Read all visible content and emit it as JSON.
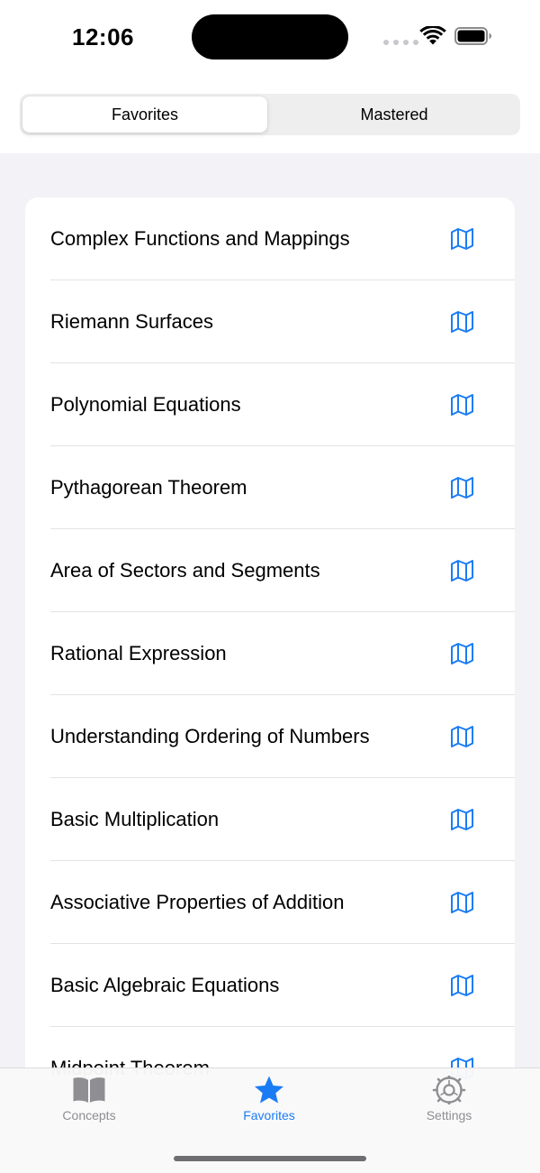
{
  "status_bar": {
    "time": "12:06"
  },
  "segmented_control": {
    "segments": [
      {
        "label": "Favorites",
        "selected": true
      },
      {
        "label": "Mastered",
        "selected": false
      }
    ]
  },
  "list": {
    "item_icon": "map-icon",
    "items": [
      {
        "label": "Complex Functions and Mappings"
      },
      {
        "label": "Riemann Surfaces"
      },
      {
        "label": "Polynomial Equations"
      },
      {
        "label": "Pythagorean Theorem"
      },
      {
        "label": "Area of Sectors and Segments"
      },
      {
        "label": "Rational Expression"
      },
      {
        "label": "Understanding Ordering of Numbers"
      },
      {
        "label": "Basic Multiplication"
      },
      {
        "label": "Associative Properties of Addition"
      },
      {
        "label": "Basic Algebraic Equations"
      },
      {
        "label": "Midpoint Theorem"
      }
    ]
  },
  "tab_bar": {
    "tabs": [
      {
        "label": "Concepts",
        "icon": "book-icon",
        "active": false
      },
      {
        "label": "Favorites",
        "icon": "star-icon",
        "active": true
      },
      {
        "label": "Settings",
        "icon": "gear-icon",
        "active": false
      }
    ]
  },
  "colors": {
    "accent": "#1a7cf5",
    "inactive": "#8e8e93",
    "background": "#f2f2f7"
  }
}
